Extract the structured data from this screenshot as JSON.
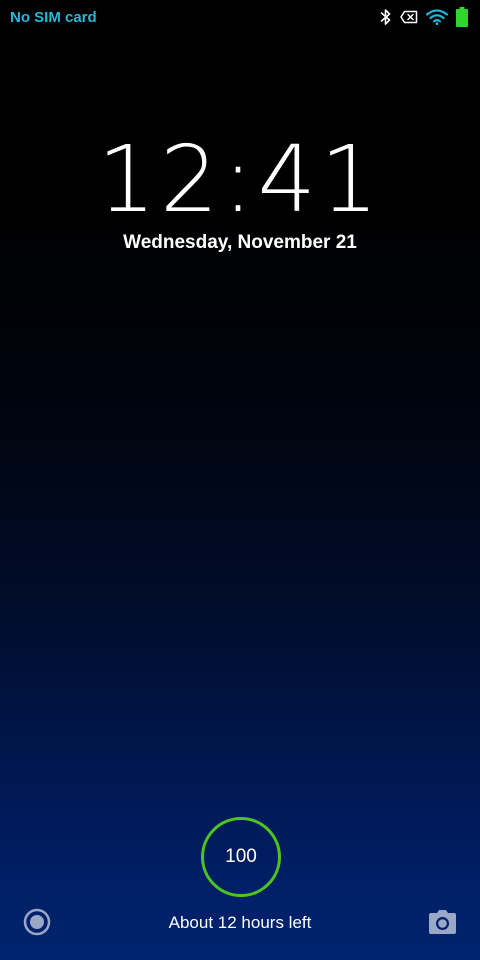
{
  "status_bar": {
    "carrier": "No SIM card",
    "icons": [
      "bluetooth-icon",
      "no-sim-icon",
      "wifi-icon",
      "battery-icon"
    ],
    "colors": {
      "carrier": "#29b6d8",
      "wifi": "#1fb5d6",
      "battery": "#2fd62b"
    }
  },
  "lockscreen": {
    "time": "12:41",
    "date": "Wednesday, November 21"
  },
  "charging": {
    "level": "100",
    "ring_color": "#4dc41f",
    "time_left": "About 12 hours left"
  },
  "shortcuts": {
    "left_icon": "voice-assist-icon",
    "right_icon": "camera-icon"
  }
}
